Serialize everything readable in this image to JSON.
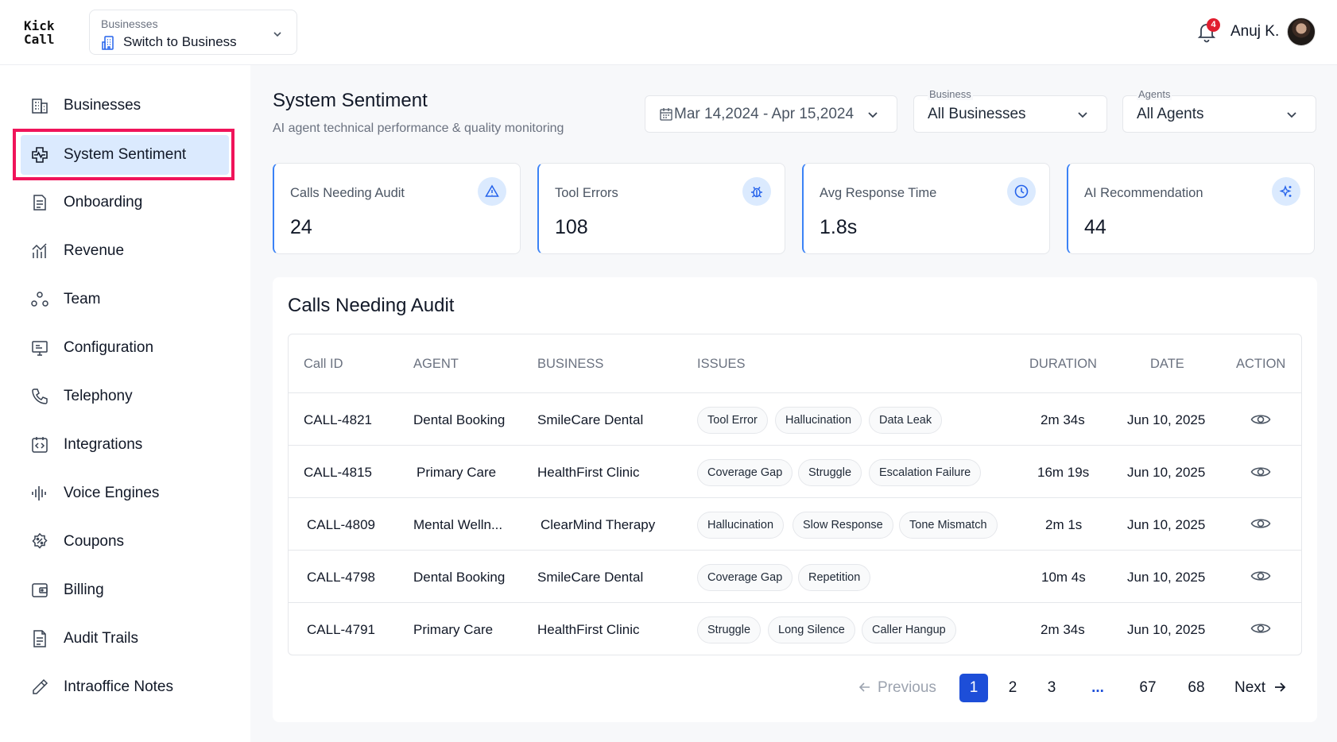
{
  "app": {
    "logo": "Kick\nCall"
  },
  "header": {
    "switcher_label": "Businesses",
    "switcher_value": "Switch to Business",
    "notifications_count": "4",
    "user_name": "Anuj K."
  },
  "sidebar": {
    "items": [
      {
        "label": "Businesses",
        "icon": "building-icon"
      },
      {
        "label": "System Sentiment",
        "icon": "heart-monitor-icon",
        "active": true
      },
      {
        "label": "Onboarding",
        "icon": "document-icon"
      },
      {
        "label": "Revenue",
        "icon": "chart-icon"
      },
      {
        "label": "Team",
        "icon": "team-icon"
      },
      {
        "label": "Configuration",
        "icon": "monitor-icon"
      },
      {
        "label": "Telephony",
        "icon": "phone-icon"
      },
      {
        "label": "Integrations",
        "icon": "code-icon"
      },
      {
        "label": "Voice Engines",
        "icon": "waveform-icon"
      },
      {
        "label": "Coupons",
        "icon": "coupon-icon"
      },
      {
        "label": "Billing",
        "icon": "wallet-icon"
      },
      {
        "label": "Audit Trails",
        "icon": "file-icon"
      },
      {
        "label": "Intraoffice Notes",
        "icon": "pencil-icon"
      }
    ]
  },
  "page": {
    "title": "System Sentiment",
    "subtitle": "AI agent technical performance & quality monitoring"
  },
  "filters": {
    "date_range": "Mar 14,2024 - Apr 15,2024",
    "business_label": "Business",
    "business_value": "All Businesses",
    "agents_label": "Agents",
    "agents_value": "All Agents"
  },
  "cards": [
    {
      "label": "Calls Needing Audit",
      "value": "24",
      "icon": "warning-icon"
    },
    {
      "label": "Tool Errors",
      "value": "108",
      "icon": "bug-icon"
    },
    {
      "label": "Avg Response Time",
      "value": "1.8s",
      "icon": "clock-icon"
    },
    {
      "label": "AI Recommendation",
      "value": "44",
      "icon": "sparkle-icon"
    }
  ],
  "audit_table": {
    "title": "Calls Needing Audit",
    "columns": [
      "Call ID",
      "AGENT",
      "BUSINESS",
      "ISSUES",
      "DURATION",
      "DATE",
      "ACTION"
    ],
    "rows": [
      {
        "call_id": "CALL-4821",
        "agent": "Dental Booking",
        "business": "SmileCare Dental",
        "issues": [
          "Tool Error",
          "Hallucination",
          "Data Leak"
        ],
        "duration": "2m 34s",
        "date": "Jun 10, 2025"
      },
      {
        "call_id": "CALL-4815",
        "agent": "Primary Care",
        "business": "HealthFirst Clinic",
        "issues": [
          "Coverage Gap",
          "Struggle",
          "Escalation Failure"
        ],
        "duration": "16m 19s",
        "date": "Jun 10, 2025"
      },
      {
        "call_id": "CALL-4809",
        "agent": "Mental Welln...",
        "business": "ClearMind Therapy",
        "issues": [
          "Hallucination",
          "Slow Response",
          "Tone Mismatch"
        ],
        "duration": "2m 1s",
        "date": "Jun 10, 2025"
      },
      {
        "call_id": "CALL-4798",
        "agent": "Dental Booking",
        "business": "SmileCare Dental",
        "issues": [
          "Coverage Gap",
          "Repetition"
        ],
        "duration": "10m 4s",
        "date": "Jun 10, 2025"
      },
      {
        "call_id": "CALL-4791",
        "agent": "Primary Care",
        "business": "HealthFirst Clinic",
        "issues": [
          "Struggle",
          "Long Silence",
          "Caller Hangup"
        ],
        "duration": "2m 34s",
        "date": "Jun 10, 2025"
      }
    ]
  },
  "pagination": {
    "previous": "Previous",
    "next": "Next",
    "pages": [
      "1",
      "2",
      "3",
      "...",
      "67",
      "68"
    ],
    "current": "1"
  },
  "colors": {
    "accent": "#1d4ed8",
    "active_bg": "#dbeafe",
    "highlight_border": "#f0145a",
    "badge": "#e11d2e"
  }
}
